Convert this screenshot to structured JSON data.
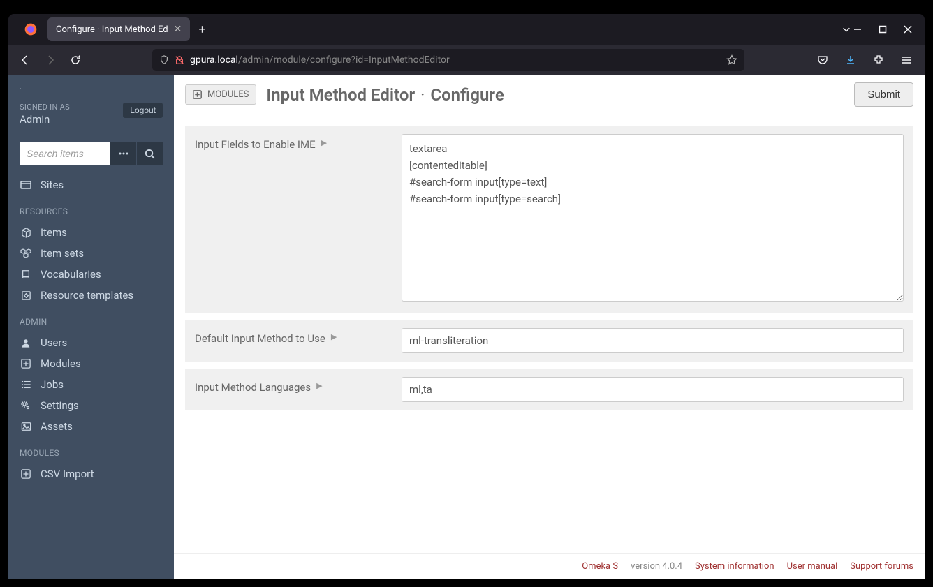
{
  "browser": {
    "tab_title": "Configure · Input Method Ed",
    "url_protocol_host": "gpura.local",
    "url_path": "/admin/module/configure?id=InputMethodEditor"
  },
  "sidebar": {
    "signed_in_label": "SIGNED IN AS",
    "signed_in_name": "Admin",
    "logout_label": "Logout",
    "search_placeholder": "Search items",
    "nav_sites": "Sites",
    "heading_resources": "RESOURCES",
    "nav_items": "Items",
    "nav_item_sets": "Item sets",
    "nav_vocabularies": "Vocabularies",
    "nav_resource_templates": "Resource templates",
    "heading_admin": "ADMIN",
    "nav_users": "Users",
    "nav_modules": "Modules",
    "nav_jobs": "Jobs",
    "nav_settings": "Settings",
    "nav_assets": "Assets",
    "heading_modules": "MODULES",
    "nav_csv_import": "CSV Import"
  },
  "header": {
    "modules_badge": "MODULES",
    "title_module": "Input Method Editor",
    "title_action": "Configure",
    "submit_label": "Submit"
  },
  "form": {
    "field1_label": "Input Fields to Enable IME",
    "field1_value": "textarea\n[contenteditable]\n#search-form input[type=text]\n#search-form input[type=search]",
    "field2_label": "Default Input Method to Use",
    "field2_value": "ml-transliteration",
    "field3_label": "Input Method Languages",
    "field3_value": "ml,ta"
  },
  "footer": {
    "brand": "Omeka S",
    "version": "version 4.0.4",
    "link_sysinfo": "System information",
    "link_manual": "User manual",
    "link_forums": "Support forums"
  }
}
